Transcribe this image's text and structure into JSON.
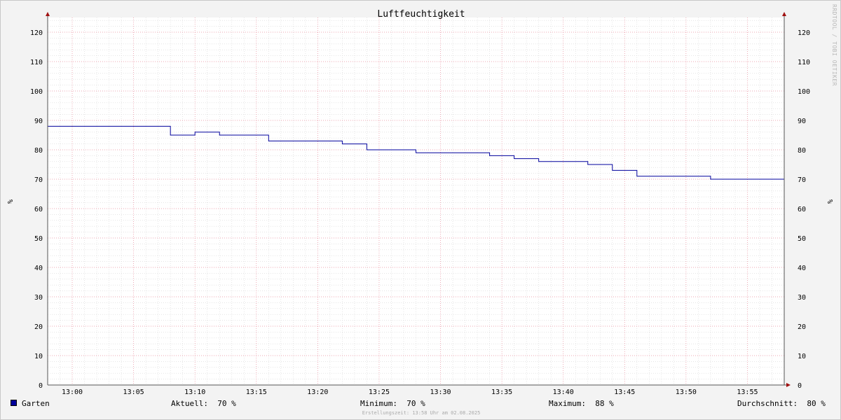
{
  "chart_data": {
    "type": "line",
    "title": "Luftfeuchtigkeit",
    "ylabel": "%",
    "ylabel_right": "%",
    "ylim": [
      0,
      125
    ],
    "yticks": [
      0,
      10,
      20,
      30,
      40,
      50,
      60,
      70,
      80,
      90,
      100,
      110,
      120
    ],
    "xlim": [
      "12:58",
      "13:58"
    ],
    "xticks": [
      "13:00",
      "13:05",
      "13:10",
      "13:15",
      "13:20",
      "13:25",
      "13:30",
      "13:35",
      "13:40",
      "13:45",
      "13:50",
      "13:55"
    ],
    "grid": true,
    "step": true,
    "series": [
      {
        "name": "Garten",
        "color": "#00009c",
        "x": [
          "12:58",
          "13:08",
          "13:10",
          "13:12",
          "13:16",
          "13:22",
          "13:24",
          "13:26",
          "13:28",
          "13:34",
          "13:36",
          "13:38",
          "13:42",
          "13:44",
          "13:46",
          "13:52",
          "13:58"
        ],
        "values": [
          88,
          85,
          86,
          85,
          83,
          82,
          80,
          80,
          79,
          78,
          77,
          76,
          75,
          73,
          71,
          70,
          70
        ]
      }
    ]
  },
  "watermark": "RRDTOOL / TOBI OETIKER",
  "legend": {
    "series_name": "Garten",
    "current": "Aktuell:  70 %",
    "minimum": "Minimum:  70 %",
    "maximum": "Maximum:  88 %",
    "average": "Durchschnitt:  80 %"
  },
  "footer": "Erstellungszeit: 13:58 Uhr am 02.08.2025"
}
